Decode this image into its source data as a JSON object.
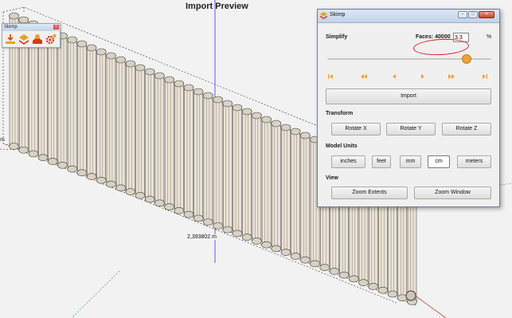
{
  "viewport": {
    "title": "Import Preview",
    "dimension_label": "2,393802 m",
    "axis_label": "m"
  },
  "toolbar": {
    "title": "Skimp",
    "close_glyph": "×",
    "icons": [
      "skimp-import-icon",
      "skimp-layers-icon",
      "skimp-settings-icon",
      "skimp-gear-icon"
    ]
  },
  "dialog": {
    "title": "Skimp",
    "window_buttons": {
      "minimize": "–",
      "maximize": "□",
      "close": "×"
    },
    "simplify": {
      "label": "Simplify",
      "faces_label": "Faces:",
      "faces_value": "40000",
      "percent_value": "3.3",
      "percent_sign": "%",
      "slider_level_percent": 85
    },
    "player_icons": [
      "skip-to-start-icon",
      "fast-rewind-icon",
      "step-back-icon",
      "step-forward-icon",
      "fast-forward-icon",
      "skip-to-end-icon"
    ],
    "import_label": "Import",
    "transform": {
      "label": "Transform",
      "buttons": [
        "Rotate X",
        "Rotate Y",
        "Rotate Z"
      ]
    },
    "model_units": {
      "label": "Model Units",
      "buttons": [
        "inches",
        "feet",
        "mm",
        "cm",
        "meters"
      ],
      "selected": "cm"
    },
    "view": {
      "label": "View",
      "buttons": [
        "Zoom Extents",
        "Zoom Window"
      ]
    }
  },
  "colors": {
    "accent": "#f0a03c",
    "player_icon": "#f0a03c",
    "annotation": "#d81e1e",
    "radiator_fill": "#e9e2d5",
    "radiator_line": "#3b3b3b"
  }
}
